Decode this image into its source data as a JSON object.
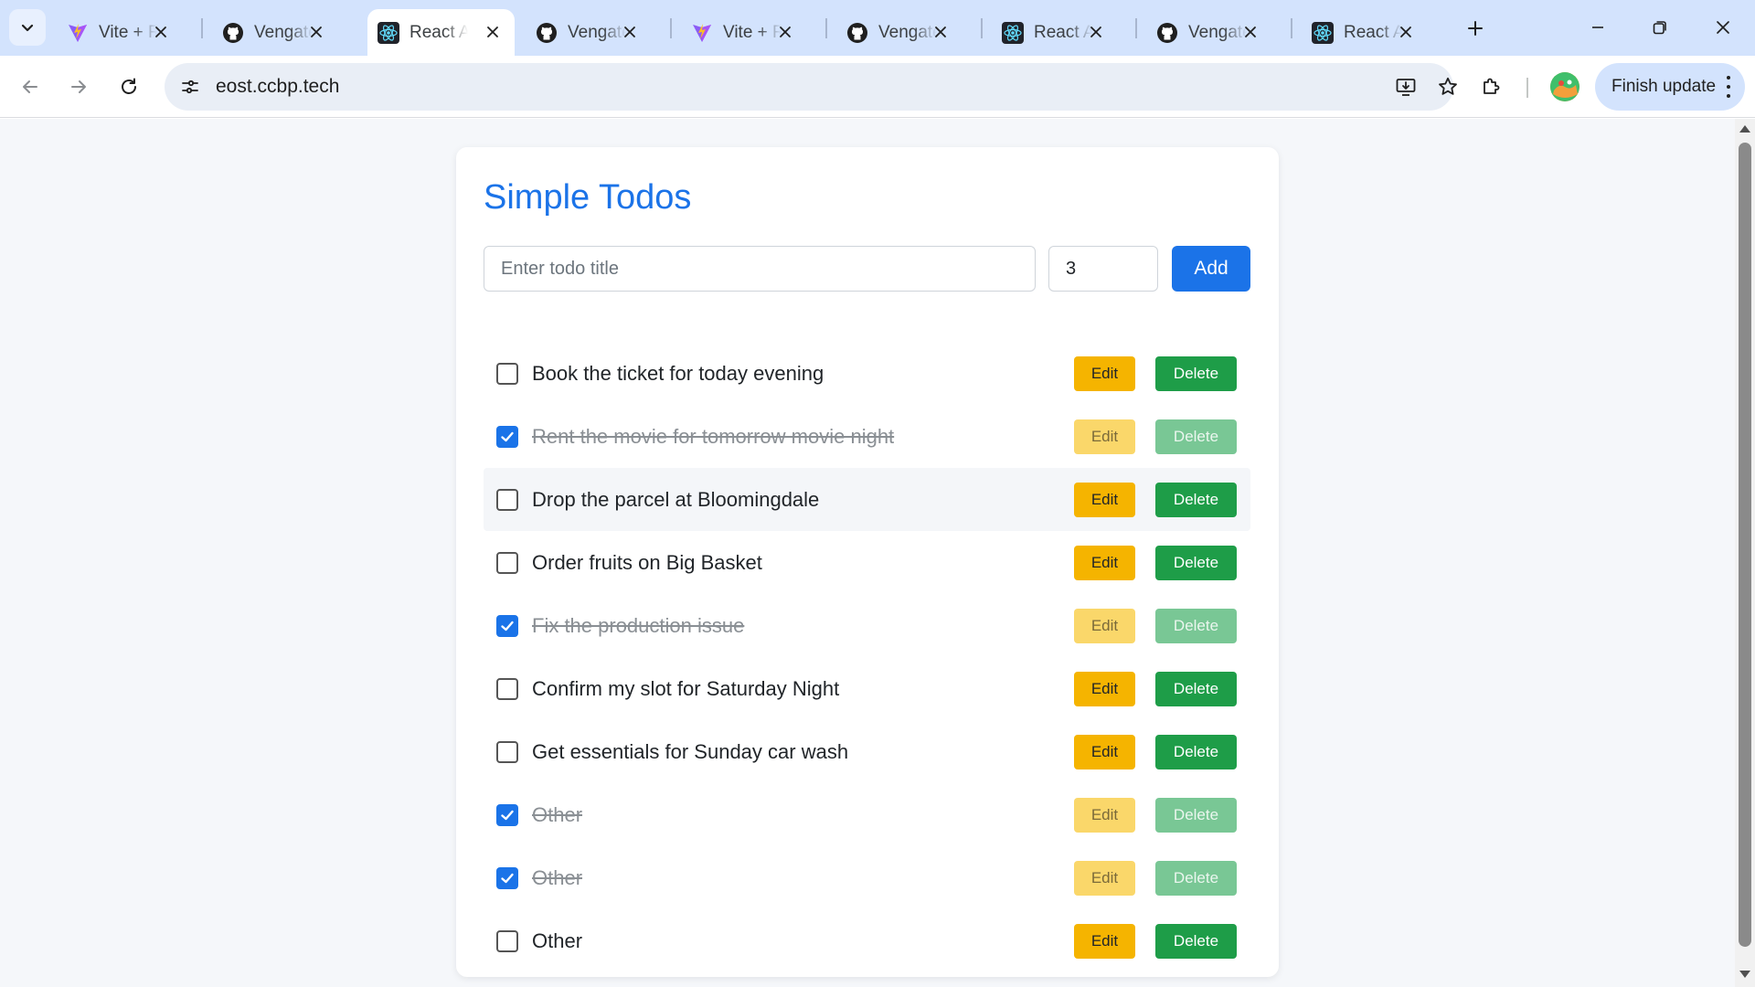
{
  "browser": {
    "tabs": [
      {
        "title": "Vite + React",
        "icon": "vite-icon",
        "active": false
      },
      {
        "title": "Vengateshr",
        "icon": "github-icon",
        "active": false
      },
      {
        "title": "React App",
        "icon": "react-icon",
        "active": true
      },
      {
        "title": "Vengateshr",
        "icon": "github-icon",
        "active": false
      },
      {
        "title": "Vite + React",
        "icon": "vite-icon",
        "active": false
      },
      {
        "title": "Vengateshr",
        "icon": "github-icon",
        "active": false
      },
      {
        "title": "React App",
        "icon": "react-icon",
        "active": false
      },
      {
        "title": "Vengateshr",
        "icon": "github-icon",
        "active": false
      },
      {
        "title": "React App",
        "icon": "react-icon",
        "active": false
      }
    ],
    "url": "eost.ccbp.tech",
    "finish_update_label": "Finish update",
    "colors": {
      "tabstrip": "#d3e3fd",
      "omnibox": "#e9eef6"
    }
  },
  "app": {
    "title": "Simple Todos",
    "input_placeholder": "Enter todo title",
    "input_value": "",
    "quantity_value": "3",
    "add_label": "Add",
    "edit_label": "Edit",
    "delete_label": "Delete",
    "colors": {
      "primary": "#1b73e8",
      "edit": "#f5b400",
      "delete": "#1e9d48",
      "page_bg": "#f5f7fa"
    },
    "todos": [
      {
        "title": "Book the ticket for today evening",
        "completed": false
      },
      {
        "title": "Rent the movie for tomorrow movie night",
        "completed": true
      },
      {
        "title": "Drop the parcel at Bloomingdale",
        "completed": false
      },
      {
        "title": "Order fruits on Big Basket",
        "completed": false
      },
      {
        "title": "Fix the production issue",
        "completed": true
      },
      {
        "title": "Confirm my slot for Saturday Night",
        "completed": false
      },
      {
        "title": "Get essentials for Sunday car wash",
        "completed": false
      },
      {
        "title": "Other",
        "completed": true
      },
      {
        "title": "Other",
        "completed": true
      },
      {
        "title": "Other",
        "completed": false
      }
    ]
  }
}
